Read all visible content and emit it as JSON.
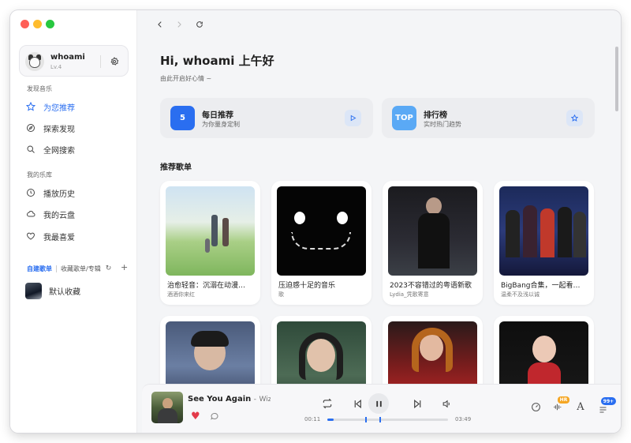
{
  "window": {
    "traffic_lights": [
      "close",
      "minimize",
      "zoom"
    ]
  },
  "user": {
    "name": "whoami",
    "level": "Lv.4"
  },
  "sidebar": {
    "discover_label": "发现音乐",
    "discover_items": [
      {
        "label": "为您推荐",
        "icon": "star-icon",
        "active": true
      },
      {
        "label": "探索发现",
        "icon": "compass-icon",
        "active": false
      },
      {
        "label": "全网搜索",
        "icon": "search-icon",
        "active": false
      }
    ],
    "library_label": "我的乐库",
    "library_items": [
      {
        "label": "播放历史",
        "icon": "clock-icon"
      },
      {
        "label": "我的云盘",
        "icon": "cloud-icon"
      },
      {
        "label": "我最喜爱",
        "icon": "heart-icon"
      }
    ],
    "playlist_tabs": {
      "created": "自建歌单",
      "collected": "收藏歌单/专辑"
    },
    "playlists": [
      {
        "name": "默认收藏"
      }
    ]
  },
  "main": {
    "greeting": "Hi, whoami 上午好",
    "greeting_sub": "由此开启好心情 ~",
    "features": [
      {
        "badge": "5",
        "title": "每日推荐",
        "subtitle": "为你量身定制",
        "badge_color": "#2a6ef0",
        "action_icon": "play-icon"
      },
      {
        "badge": "TOP",
        "title": "排行榜",
        "subtitle": "实时热门趋势",
        "badge_color": "#5aa9f5",
        "action_icon": "star-icon"
      }
    ],
    "section_title": "推荐歌单",
    "playlists": [
      {
        "title": "治愈轻音：沉溺在动漫…",
        "creator": "酒酒你来红"
      },
      {
        "title": "压迫感十足的音乐",
        "creator": "歌"
      },
      {
        "title": "2023不容错过的粤语新歌",
        "creator": "Lydia_凭歌寄意"
      },
      {
        "title": "BigBang合集，一起看…",
        "creator": "温柔不及浅以诚"
      }
    ]
  },
  "player": {
    "song": "See You Again",
    "separator": "-",
    "artist": "Wiz Khalifa",
    "current_time": "00:11",
    "total_time": "03:49",
    "progress": 0.05,
    "liked": true,
    "quality_badge": "HR",
    "queue_badge": "99+"
  }
}
